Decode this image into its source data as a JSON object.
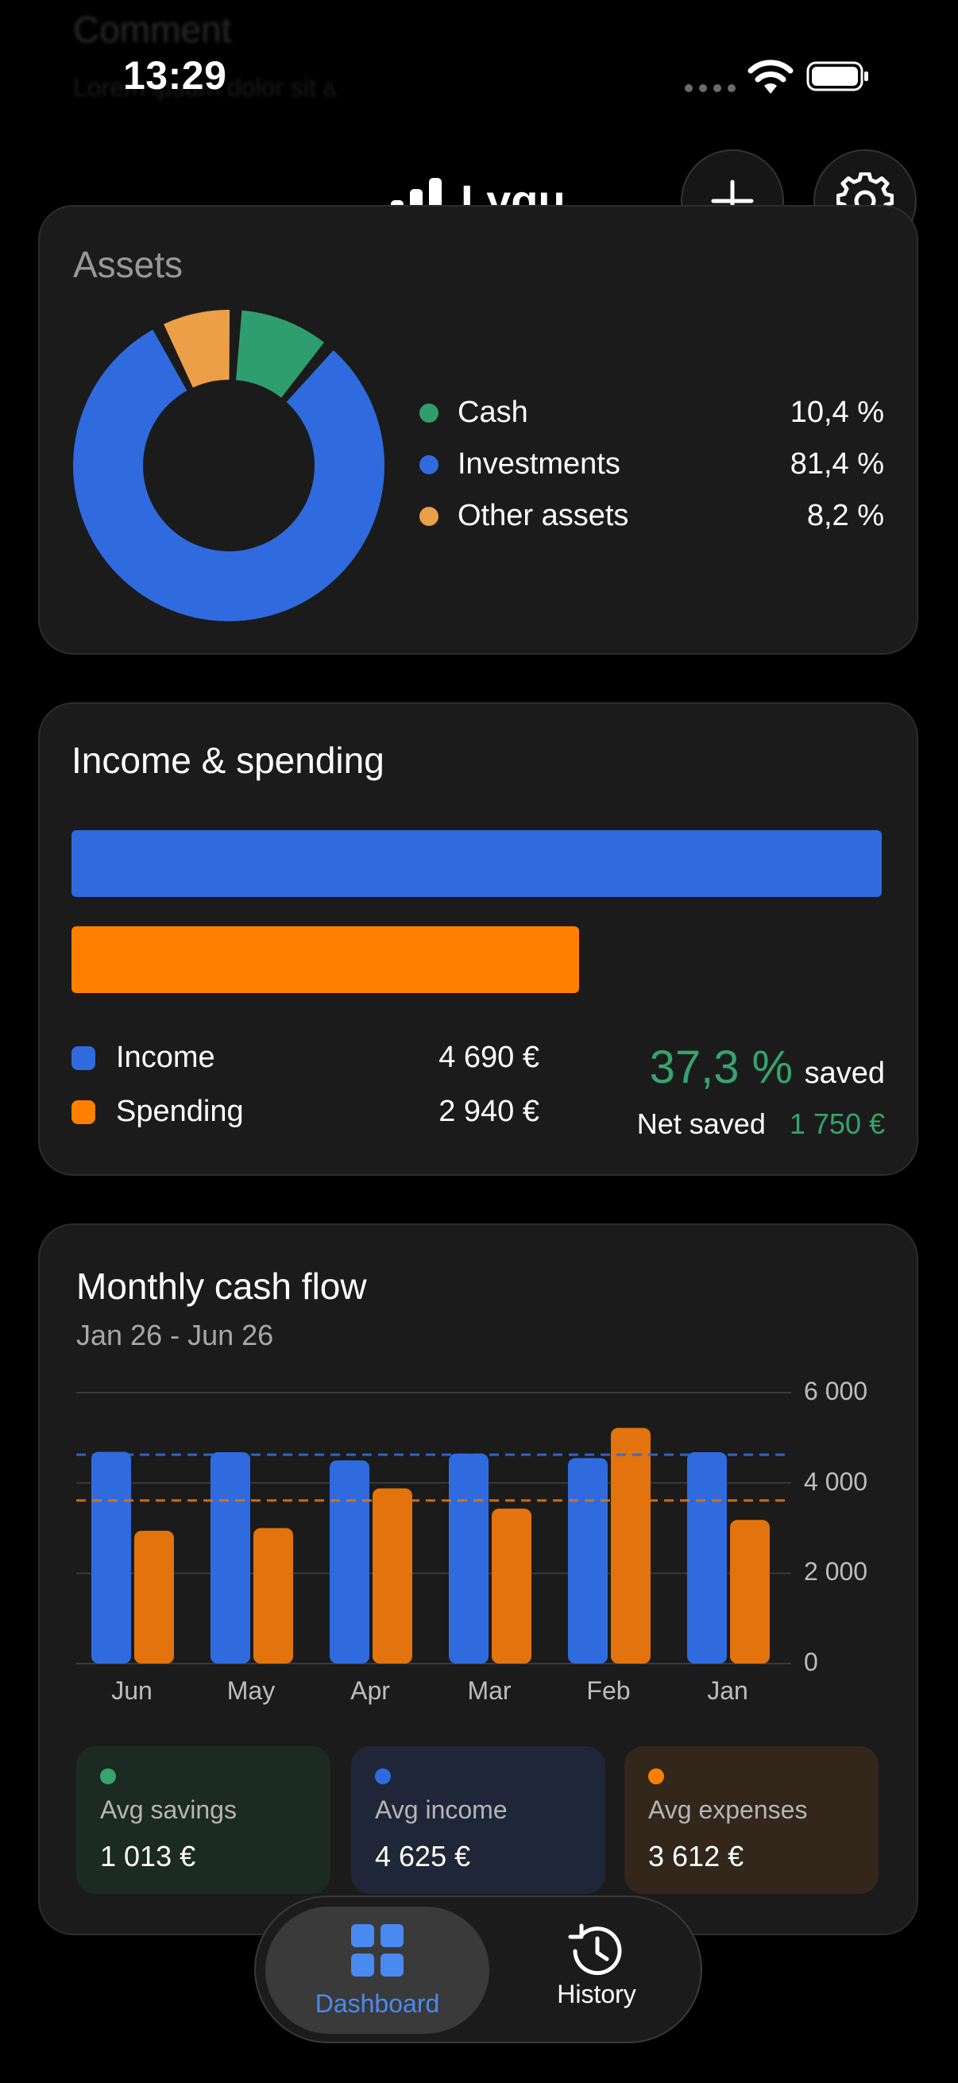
{
  "background": {
    "ghost_title": "Comment",
    "ghost_sub": "Lorem ipsum dolor sit amet"
  },
  "status_bar": {
    "time": "13:29"
  },
  "header": {
    "app_name": "Lygu"
  },
  "assets": {
    "title": "Assets",
    "items": [
      {
        "label": "Cash",
        "value": "10,4 %",
        "color": "#2f9e6e"
      },
      {
        "label": "Investments",
        "value": "81,4 %",
        "color": "#2f6bde"
      },
      {
        "label": "Other assets",
        "value": "8,2 %",
        "color": "#eba047"
      }
    ]
  },
  "income_spending": {
    "title": "Income & spending",
    "income_label": "Income",
    "income_value": "4 690 €",
    "spending_label": "Spending",
    "spending_value": "2 940 €",
    "saved_pct": "37,3 %",
    "saved_label": "saved",
    "net_saved_label": "Net saved",
    "net_saved_value": "1 750 €",
    "income_color": "#2f6bde",
    "spending_color": "#ff8000",
    "highlight_color": "#35a46d"
  },
  "cash_flow": {
    "title": "Monthly cash flow",
    "date_range": "Jan 26 - Jun 26",
    "avg_savings_label": "Avg savings",
    "avg_savings_value": "1 013 €",
    "avg_income_label": "Avg income",
    "avg_income_value": "4 625 €",
    "avg_expenses_label": "Avg expenses",
    "avg_expenses_value": "3 612 €"
  },
  "chart_data": {
    "type": "bar",
    "categories": [
      "Jun",
      "May",
      "Apr",
      "Mar",
      "Feb",
      "Jan"
    ],
    "series": [
      {
        "values": [
          4690,
          4680,
          4500,
          4650,
          4550,
          4680
        ],
        "color": "#2f6bde"
      },
      {
        "values": [
          2940,
          3000,
          3880,
          3430,
          5220,
          3180
        ],
        "color": "#e2730d"
      }
    ],
    "yticks": [
      "6 000",
      "4 000",
      "2 000",
      "0"
    ],
    "ylim": [
      0,
      6000
    ],
    "reference_lines": [
      4625,
      3612
    ],
    "grid": true
  },
  "tabs": [
    {
      "label": "Dashboard",
      "active": true
    },
    {
      "label": "History",
      "active": false
    }
  ]
}
